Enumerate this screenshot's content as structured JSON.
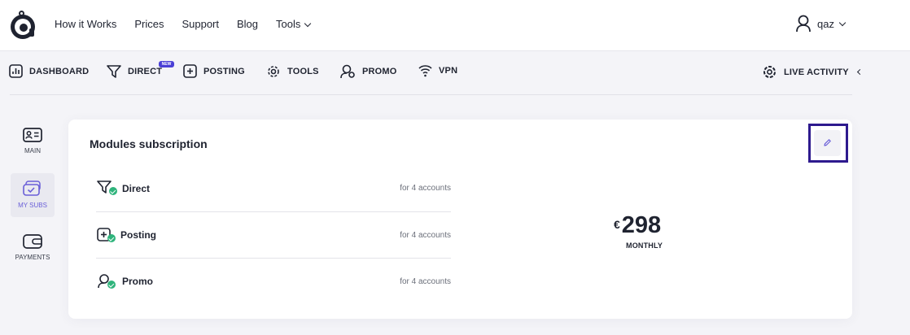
{
  "header": {
    "nav": [
      "How it Works",
      "Prices",
      "Support",
      "Blog"
    ],
    "tools_label": "Tools",
    "username": "qaz"
  },
  "mainnav": {
    "items": [
      "DASHBOARD",
      "DIRECT",
      "POSTING",
      "TOOLS",
      "PROMO",
      "VPN"
    ],
    "new_badge": "NEW",
    "live_activity": "LIVE ACTIVITY"
  },
  "sidebar": {
    "items": [
      "MAIN",
      "MY SUBS",
      "PAYMENTS"
    ],
    "active": "MY SUBS"
  },
  "card": {
    "title": "Modules subscription",
    "modules": [
      {
        "name": "Direct",
        "accounts": "for 4 accounts"
      },
      {
        "name": "Posting",
        "accounts": "for 4 accounts"
      },
      {
        "name": "Promo",
        "accounts": "for 4 accounts"
      }
    ],
    "currency": "€",
    "price": "298",
    "period": "MONTHLY"
  },
  "colors": {
    "accent": "#4a3fd6",
    "check": "#2fb47c",
    "highlight_border": "#2e1a8e"
  },
  "icons": [
    "logo-icon",
    "user-icon",
    "dashboard-icon",
    "direct-icon",
    "posting-icon",
    "tools-icon",
    "promo-icon",
    "vpn-icon",
    "live-activity-icon",
    "main-icon",
    "my-subs-icon",
    "payments-icon",
    "pencil-icon",
    "check-icon"
  ]
}
